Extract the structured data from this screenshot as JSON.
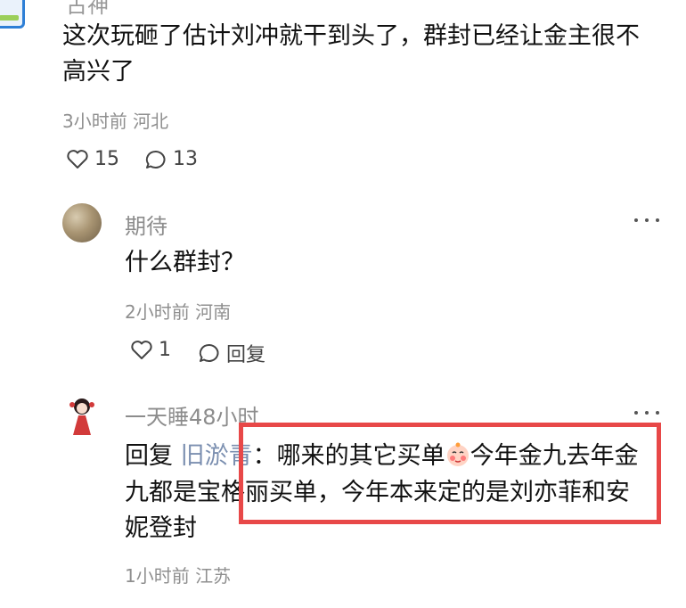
{
  "top_comment": {
    "author": "古神",
    "text_line1": "这次玩砸了估计刘冲就干到头了，群封已经让金主很不",
    "text_line2": "高兴了",
    "time_location": "3小时前 河北",
    "likes": "15",
    "replies": "13"
  },
  "reply1": {
    "username": "期待",
    "text": "什么群封？",
    "time_location": "2小时前 河南",
    "likes": "1",
    "reply_label": "回复"
  },
  "reply2": {
    "username": "一天睡48小时",
    "reply_prefix": "回复",
    "reply_target": "旧淤青",
    "text_part1": "：哪来的其它买单",
    "text_part2": "今年金九去年金",
    "text_line2": "九都是宝格丽买单，今年本来定的是刘亦菲和安",
    "text_line3": "妮登封",
    "time_location": "1小时前 江苏"
  },
  "icons": {
    "like": "heart-outline-icon",
    "comment": "speech-bubble-icon",
    "more": "more-dots-icon",
    "emoji": "blush-face-emoji"
  },
  "colors": {
    "highlight": "#e84848",
    "reply_target": "#7b8fb0",
    "meta": "#8f8f8f"
  }
}
